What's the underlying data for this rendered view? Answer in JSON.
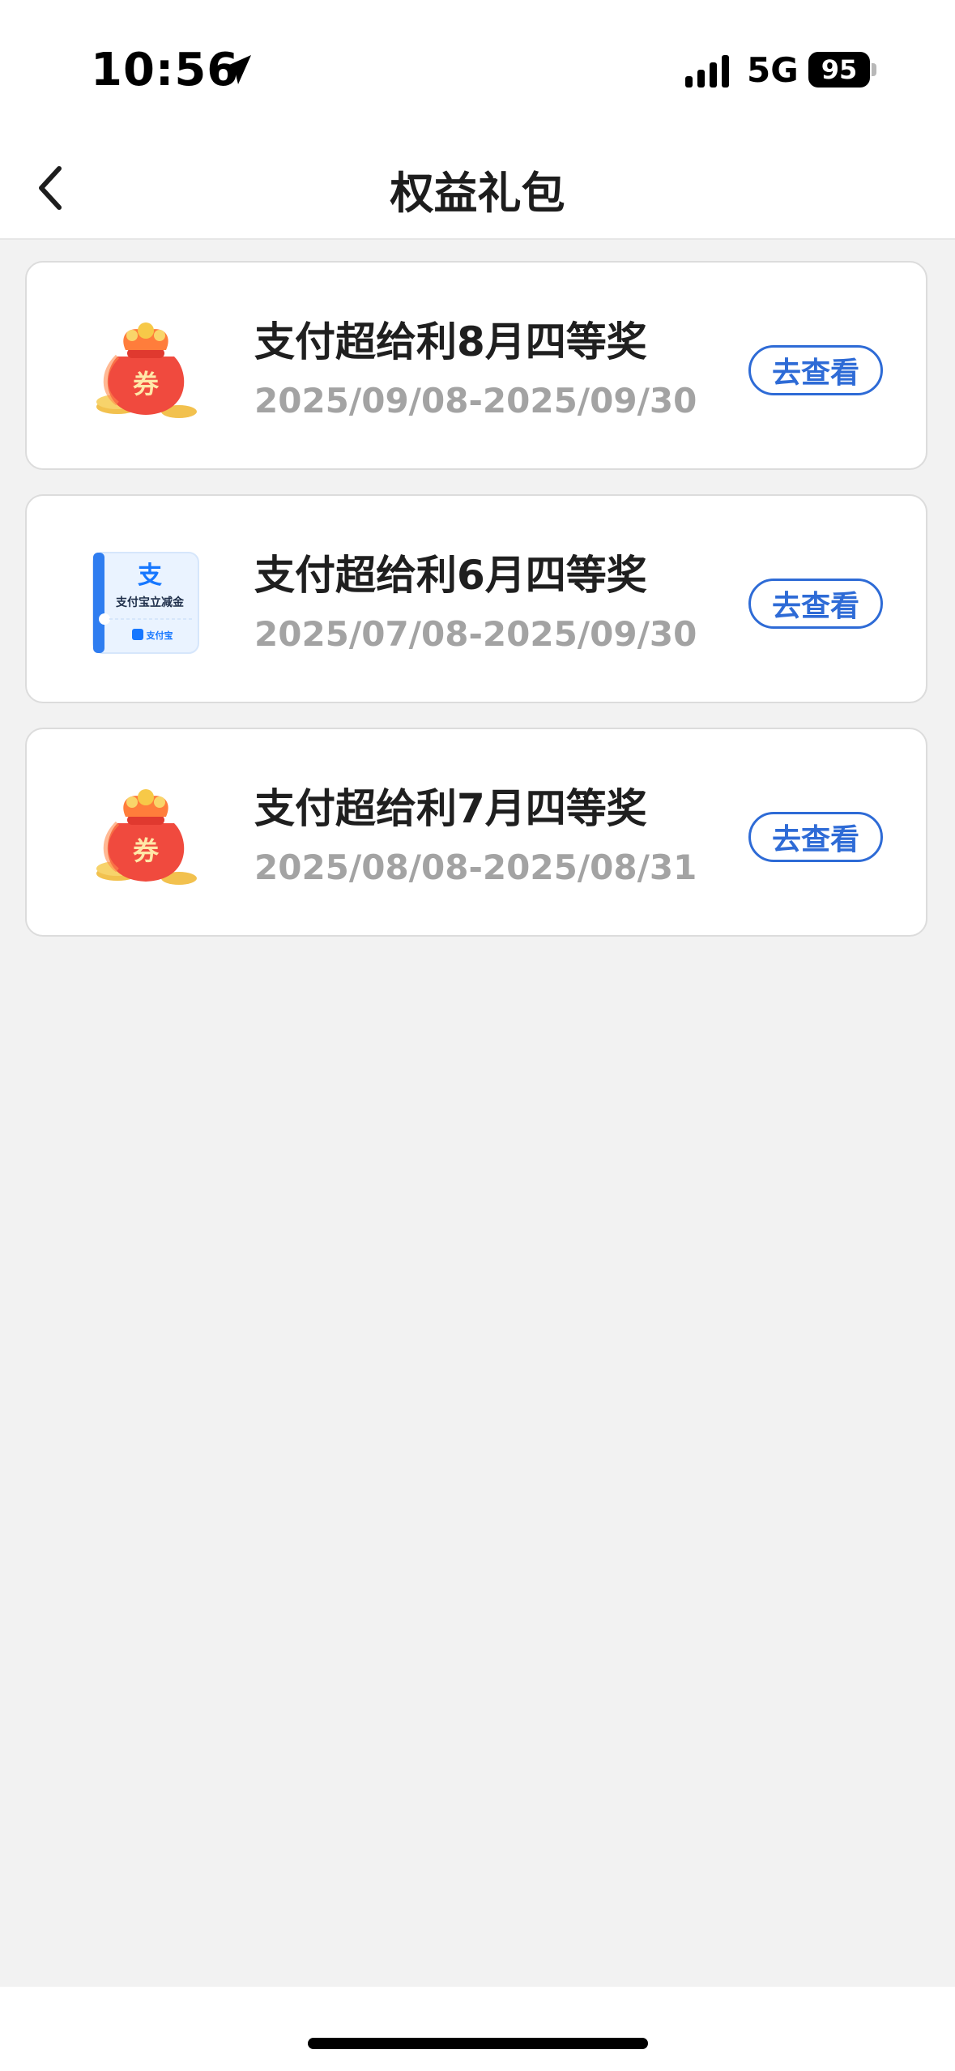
{
  "status_bar": {
    "time": "10:56",
    "network": "5G",
    "battery": "95"
  },
  "header": {
    "title": "权益礼包"
  },
  "rewards": [
    {
      "title": "支付超给利8月四等奖",
      "date_range": "2025/09/08-2025/09/30",
      "icon": "red-coupon-bag-icon",
      "action_label": "去查看"
    },
    {
      "title": "支付超给利6月四等奖",
      "date_range": "2025/07/08-2025/09/30",
      "icon": "alipay-discount-voucher-icon",
      "voucher_text": "支付宝立减金",
      "voucher_brand": "支付宝",
      "action_label": "去查看"
    },
    {
      "title": "支付超给利7月四等奖",
      "date_range": "2025/08/08-2025/08/31",
      "icon": "red-coupon-bag-icon",
      "action_label": "去查看"
    }
  ],
  "coupon_char": "券",
  "colors": {
    "accent": "#2e6bd6",
    "background": "#f2f2f2",
    "date_text": "#a3a3a3",
    "bag_red": "#f04a3e"
  }
}
